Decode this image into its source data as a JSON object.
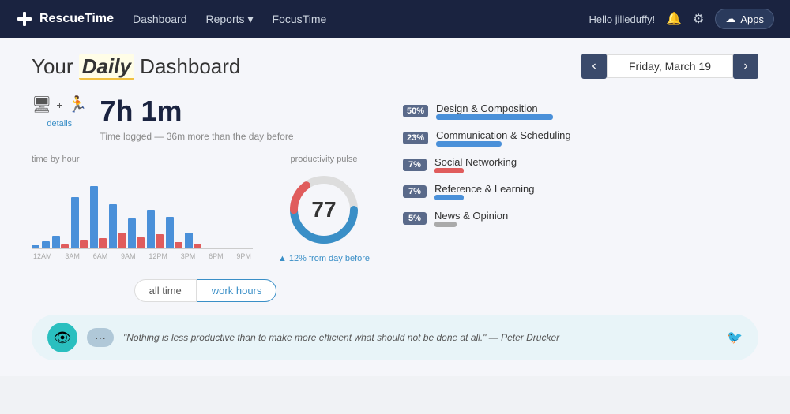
{
  "nav": {
    "brand": "RescueTime",
    "links": [
      {
        "label": "Dashboard",
        "name": "nav-dashboard"
      },
      {
        "label": "Reports",
        "name": "nav-reports",
        "has_arrow": true
      },
      {
        "label": "FocusTime",
        "name": "nav-focustime"
      }
    ],
    "user": "Hello jilleduffy!",
    "apps_button": "Apps"
  },
  "header": {
    "title_prefix": "Your",
    "title_em": "Daily",
    "title_suffix": "Dashboard",
    "date": "Friday, March 19"
  },
  "stats": {
    "time": "7h 1m",
    "detail_link": "details",
    "subtitle": "Time logged — 36m more than the day before"
  },
  "chart": {
    "label": "time by hour",
    "time_labels": [
      "12AM",
      "3AM",
      "6AM",
      "9AM",
      "12PM",
      "3PM",
      "6PM",
      "9PM"
    ],
    "bars": [
      {
        "blue": 5,
        "red": 0
      },
      {
        "blue": 8,
        "red": 0
      },
      {
        "blue": 15,
        "red": 5
      },
      {
        "blue": 70,
        "red": 10
      },
      {
        "blue": 85,
        "red": 12
      },
      {
        "blue": 60,
        "red": 20
      },
      {
        "blue": 40,
        "red": 15
      },
      {
        "blue": 55,
        "red": 18
      },
      {
        "blue": 45,
        "red": 8
      },
      {
        "blue": 20,
        "red": 5
      }
    ]
  },
  "pulse": {
    "label": "productivity pulse",
    "value": "77",
    "sub": "▲ 12% from day before"
  },
  "categories": [
    {
      "pct": "50%",
      "name": "Design & Composition",
      "bar_pct": 80,
      "color": "blue"
    },
    {
      "pct": "23%",
      "name": "Communication & Scheduling",
      "bar_pct": 45,
      "color": "blue"
    },
    {
      "pct": "7%",
      "name": "Social Networking",
      "bar_pct": 20,
      "color": "red"
    },
    {
      "pct": "7%",
      "name": "Reference & Learning",
      "bar_pct": 20,
      "color": "blue"
    },
    {
      "pct": "5%",
      "name": "News & Opinion",
      "bar_pct": 15,
      "color": "gray2"
    }
  ],
  "toggle": {
    "options": [
      "all time",
      "work hours"
    ],
    "active": "work hours"
  },
  "quote": {
    "text": "\"Nothing is less productive than to make more efficient what should not be done at all.\" — Peter Drucker"
  }
}
